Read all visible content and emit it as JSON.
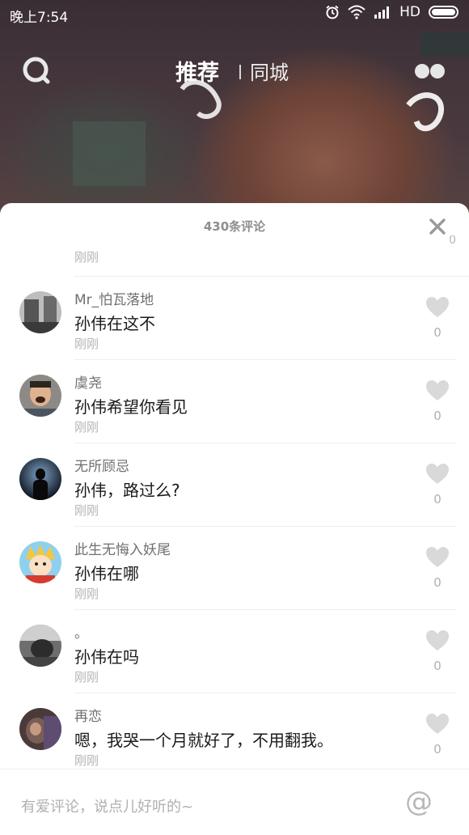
{
  "status_bar": {
    "time": "晚上7:54",
    "network": "HD"
  },
  "nav": {
    "tab_recommend": "推荐",
    "tab_local": "同城",
    "search_icon": "search-icon",
    "more_icon": "dots-icon"
  },
  "sheet": {
    "title": "430条评论",
    "close_icon": "close-icon",
    "partial_time": "刚刚",
    "partial_like": "0"
  },
  "comments": [
    {
      "username": "Mr_怕瓦落地",
      "text": "孙伟在这不",
      "time": "刚刚",
      "likes": "0"
    },
    {
      "username": "虞尧",
      "text": "孙伟希望你看见",
      "time": "刚刚",
      "likes": "0"
    },
    {
      "username": "无所顾忌",
      "text": "孙伟，路过么?",
      "time": "刚刚",
      "likes": "0"
    },
    {
      "username": "此生无悔入妖尾",
      "text": "孙伟在哪",
      "time": "刚刚",
      "likes": "0"
    },
    {
      "username": "。",
      "text": "孙伟在吗",
      "time": "刚刚",
      "likes": "0"
    },
    {
      "username": "再恋",
      "text": "嗯，我哭一个月就好了，不用翻我。",
      "time": "刚刚",
      "likes": "0"
    }
  ],
  "input": {
    "placeholder": "有爱评论，说点儿好听的~",
    "at_symbol": "@"
  }
}
